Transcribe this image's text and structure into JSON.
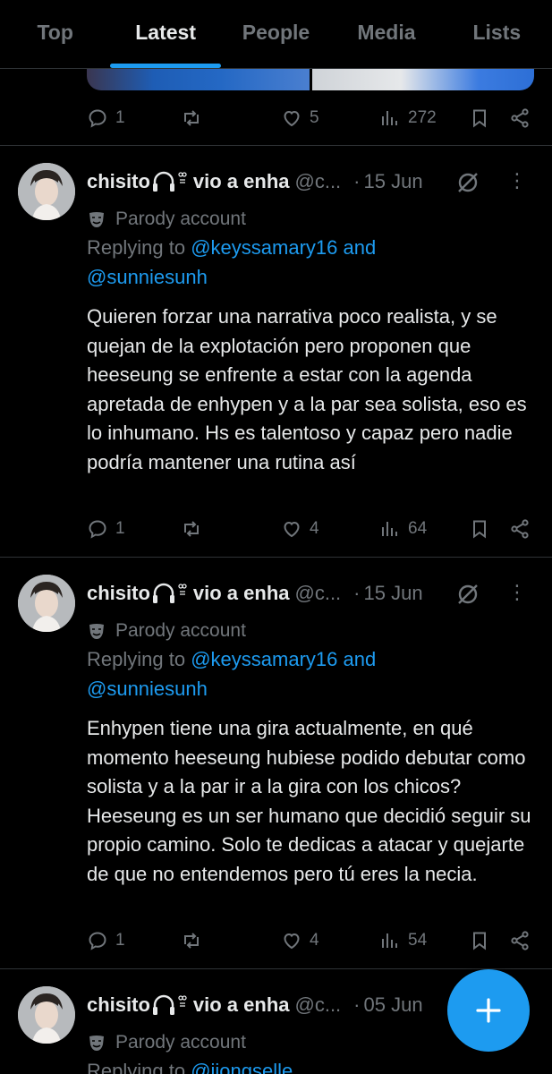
{
  "tabs": [
    {
      "label": "Top",
      "active": false
    },
    {
      "label": "Latest",
      "active": true
    },
    {
      "label": "People",
      "active": false
    },
    {
      "label": "Media",
      "active": false
    },
    {
      "label": "Lists",
      "active": false
    }
  ],
  "colors": {
    "accent": "#1d9bf0",
    "muted": "#71767b",
    "background": "#000000",
    "text": "#e7e9ea"
  },
  "top_actions": {
    "replies": "1",
    "likes": "5",
    "views": "272"
  },
  "posts": [
    {
      "name": "chisito",
      "name_suffix": "vio a enha",
      "handle": "@c...",
      "date": "15 Jun",
      "parody_label": "Parody account",
      "replying_prefix": "Replying to",
      "mention_1": "@keyssamary16",
      "and_text": "and",
      "mention_2": "@sunniesunh",
      "text": "Quieren forzar una narrativa poco realista, y se quejan de la explotación pero proponen que heeseung se enfrente a estar con la agenda apretada de enhypen y a la par sea solista, eso es lo inhumano. Hs es talentoso y capaz pero nadie podría mantener una rutina así",
      "replies": "1",
      "likes": "4",
      "views": "64"
    },
    {
      "name": "chisito",
      "name_suffix": "vio a enha",
      "handle": "@c...",
      "date": "15 Jun",
      "parody_label": "Parody account",
      "replying_prefix": "Replying to",
      "mention_1": "@keyssamary16",
      "and_text": "and",
      "mention_2": "@sunniesunh",
      "text": "Enhypen tiene una gira actualmente, en qué momento heeseung hubiese podido debutar como solista y a la par ir a la gira con los chicos? Heeseung es un ser humano que decidió seguir su propio camino. Solo te dedicas a atacar y quejarte de que no entendemos pero tú eres la necia.",
      "replies": "1",
      "likes": "4",
      "views": "54"
    },
    {
      "name": "chisito",
      "name_suffix": "vio a enha",
      "handle": "@c...",
      "date": "05 Jun",
      "parody_label": "Parody account",
      "replying_prefix": "Replying to",
      "mention_1": "@jiongselle"
    }
  ],
  "fab_icon": "plus-icon"
}
